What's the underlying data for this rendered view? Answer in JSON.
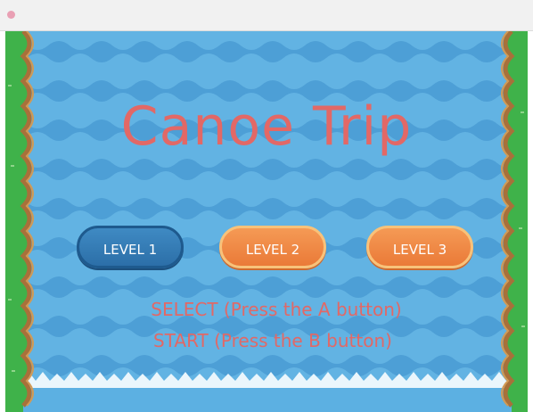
{
  "game": {
    "title": "Canoe Trip",
    "levels": [
      {
        "label": "LEVEL 1",
        "state": "selected"
      },
      {
        "label": "LEVEL 2",
        "state": "normal"
      },
      {
        "label": "LEVEL 3",
        "state": "normal"
      }
    ],
    "instructions": {
      "select": "SELECT (Press the A button)",
      "start": "START (Press the B button)"
    }
  },
  "colors": {
    "water": "#62b3e3",
    "wave": "#4a9fd8",
    "grass": "#3fb24a",
    "bank": "#a8703a",
    "title_text": "#e26866",
    "selected_button": "#2c6fa8",
    "unselected_button": "#ea7a38"
  }
}
